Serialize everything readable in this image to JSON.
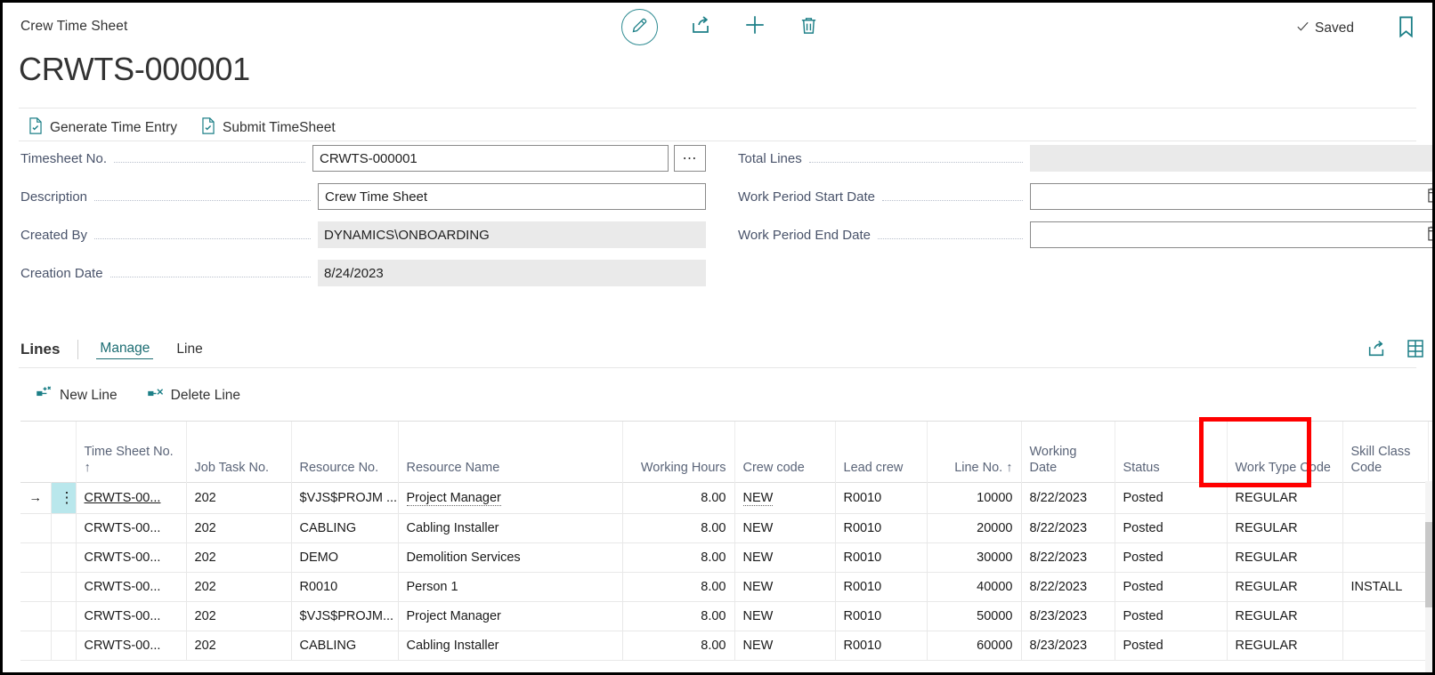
{
  "window": {
    "breadcrumb": "Crew Time Sheet",
    "page_title": "CRWTS-000001",
    "saved_status": "Saved"
  },
  "top_actions": [
    {
      "name": "edit-button",
      "icon": "pencil-icon",
      "label": "Edit"
    },
    {
      "name": "share-button",
      "icon": "share-icon",
      "label": "Share"
    },
    {
      "name": "new-button",
      "icon": "plus-icon",
      "label": "New"
    },
    {
      "name": "delete-button",
      "icon": "trash-icon",
      "label": "Delete"
    }
  ],
  "action_bar": {
    "generate_time_entry": "Generate Time Entry",
    "submit_timesheet": "Submit TimeSheet"
  },
  "form": {
    "left": [
      {
        "label": "Timesheet No.",
        "value": "CRWTS-000001",
        "readonly": false,
        "has_ellipsis": true
      },
      {
        "label": "Description",
        "value": "Crew Time Sheet",
        "readonly": false,
        "has_ellipsis": false
      },
      {
        "label": "Created By",
        "value": "DYNAMICS\\ONBOARDING",
        "readonly": true,
        "has_ellipsis": false
      },
      {
        "label": "Creation Date",
        "value": "8/24/2023",
        "readonly": true,
        "has_ellipsis": false
      }
    ],
    "right": [
      {
        "label": "Total Lines",
        "value": "",
        "readonly": true,
        "has_calendar": false
      },
      {
        "label": "Work Period Start Date",
        "value": "",
        "readonly": false,
        "has_calendar": true
      },
      {
        "label": "Work Period End Date",
        "value": "",
        "readonly": false,
        "has_calendar": true
      }
    ]
  },
  "lines_section": {
    "title": "Lines",
    "tabs": [
      {
        "label": "Manage",
        "active": true
      },
      {
        "label": "Line",
        "active": false
      }
    ],
    "sub_actions": {
      "new_line": "New Line",
      "delete_line": "Delete Line"
    },
    "columns": [
      {
        "key": "time_sheet_no",
        "label": "Time Sheet No.",
        "sort": "↑",
        "align": "left"
      },
      {
        "key": "job_task_no",
        "label": "Job Task No.",
        "sort": "",
        "align": "left"
      },
      {
        "key": "resource_no",
        "label": "Resource No.",
        "sort": "",
        "align": "left"
      },
      {
        "key": "resource_name",
        "label": "Resource Name",
        "sort": "",
        "align": "left"
      },
      {
        "key": "working_hours",
        "label": "Working Hours",
        "sort": "",
        "align": "right"
      },
      {
        "key": "crew_code",
        "label": "Crew code",
        "sort": "",
        "align": "left"
      },
      {
        "key": "lead_crew",
        "label": "Lead crew",
        "sort": "",
        "align": "left"
      },
      {
        "key": "line_no",
        "label": "Line No.",
        "sort": "↑",
        "align": "right"
      },
      {
        "key": "working_date",
        "label": "Working Date",
        "sort": "",
        "align": "left"
      },
      {
        "key": "status",
        "label": "Status",
        "sort": "",
        "align": "left"
      },
      {
        "key": "work_type_code",
        "label": "Work Type Code",
        "sort": "",
        "align": "left"
      },
      {
        "key": "skill_class_code",
        "label": "Skill Class Code",
        "sort": "",
        "align": "left"
      }
    ],
    "rows": [
      {
        "selected": true,
        "time_sheet_no": "CRWTS-00...",
        "job_task_no": "202",
        "resource_no": "$VJS$PROJM ...",
        "resource_name": "Project Manager",
        "working_hours": "8.00",
        "crew_code": "NEW",
        "lead_crew": "R0010",
        "line_no": "10000",
        "working_date": "8/22/2023",
        "status": "Posted",
        "work_type_code": "REGULAR",
        "skill_class_code": ""
      },
      {
        "selected": false,
        "time_sheet_no": "CRWTS-00...",
        "job_task_no": "202",
        "resource_no": "CABLING",
        "resource_name": "Cabling Installer",
        "working_hours": "8.00",
        "crew_code": "NEW",
        "lead_crew": "R0010",
        "line_no": "20000",
        "working_date": "8/22/2023",
        "status": "Posted",
        "work_type_code": "REGULAR",
        "skill_class_code": ""
      },
      {
        "selected": false,
        "time_sheet_no": "CRWTS-00...",
        "job_task_no": "202",
        "resource_no": "DEMO",
        "resource_name": "Demolition Services",
        "working_hours": "8.00",
        "crew_code": "NEW",
        "lead_crew": "R0010",
        "line_no": "30000",
        "working_date": "8/22/2023",
        "status": "Posted",
        "work_type_code": "REGULAR",
        "skill_class_code": ""
      },
      {
        "selected": false,
        "time_sheet_no": "CRWTS-00...",
        "job_task_no": "202",
        "resource_no": "R0010",
        "resource_name": "Person 1",
        "working_hours": "8.00",
        "crew_code": "NEW",
        "lead_crew": "R0010",
        "line_no": "40000",
        "working_date": "8/22/2023",
        "status": "Posted",
        "work_type_code": "REGULAR",
        "skill_class_code": "INSTALL"
      },
      {
        "selected": false,
        "time_sheet_no": "CRWTS-00...",
        "job_task_no": "202",
        "resource_no": "$VJS$PROJM...",
        "resource_name": "Project Manager",
        "working_hours": "8.00",
        "crew_code": "NEW",
        "lead_crew": "R0010",
        "line_no": "50000",
        "working_date": "8/23/2023",
        "status": "Posted",
        "work_type_code": "REGULAR",
        "skill_class_code": ""
      },
      {
        "selected": false,
        "time_sheet_no": "CRWTS-00...",
        "job_task_no": "202",
        "resource_no": "CABLING",
        "resource_name": "Cabling Installer",
        "working_hours": "8.00",
        "crew_code": "NEW",
        "lead_crew": "R0010",
        "line_no": "60000",
        "working_date": "8/23/2023",
        "status": "Posted",
        "work_type_code": "REGULAR",
        "skill_class_code": ""
      }
    ]
  },
  "colors": {
    "accent_teal": "#1c6d73",
    "highlight_red": "#ff0000",
    "selected_cell": "#b9e7ec",
    "label_text": "#49536a"
  }
}
